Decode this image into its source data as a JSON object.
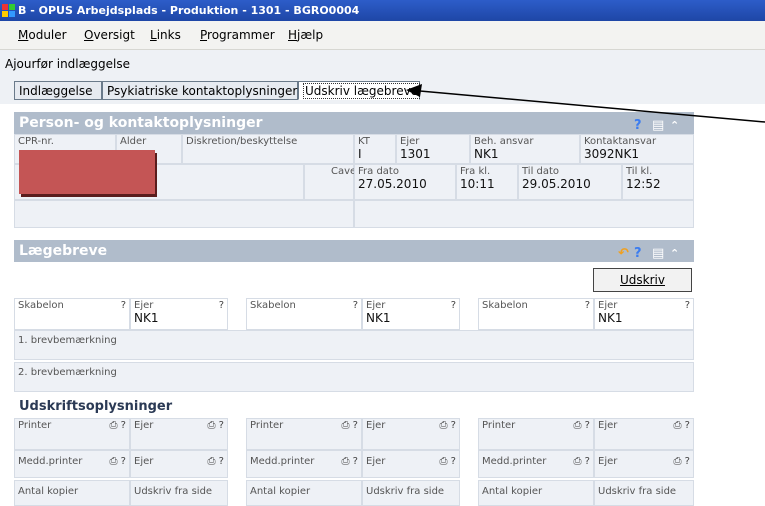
{
  "window": {
    "title": "B - OPUS Arbejdsplads - Produktion - 1301 - BGRO0004"
  },
  "menu": [
    {
      "label": "Moduler",
      "u": "M",
      "rest": "oduler"
    },
    {
      "label": "Oversigt",
      "u": "O",
      "rest": "versigt"
    },
    {
      "label": "Links",
      "u": "L",
      "rest": "inks"
    },
    {
      "label": "Programmer",
      "u": "P",
      "rest": "rogrammer"
    },
    {
      "label": "Hjælp",
      "u": "H",
      "rest": "jælp"
    }
  ],
  "subbar": {
    "label": "Ajourfør indlæggelse"
  },
  "tabs": [
    {
      "label": "Indlæggelse"
    },
    {
      "label": "Psykiatriske kontaktoplysninger"
    },
    {
      "label": "Udskriv lægebreve"
    }
  ],
  "person": {
    "header": "Person- og kontaktoplysninger",
    "cpr_label": "CPR-nr.",
    "alder_label": "Alder",
    "diskretion_label": "Diskretion/beskyttelse",
    "kt_label": "KT",
    "kt_value": "I",
    "ejer_label": "Ejer",
    "ejer_value": "1301",
    "beh_label": "Beh. ansvar",
    "beh_value": "NK1",
    "kontakt_label": "Kontaktansvar",
    "kontakt_value": "3092NK1",
    "cave_label": "Cave",
    "fra_dato_label": "Fra dato",
    "fra_dato_value": "27.05.2010",
    "fra_kl_label": "Fra kl.",
    "fra_kl_value": "10:11",
    "til_dato_label": "Til dato",
    "til_dato_value": "29.05.2010",
    "til_kl_label": "Til kl.",
    "til_kl_value": "12:52"
  },
  "laegebreve": {
    "header": "Lægebreve",
    "print_button": "Udskriv",
    "skabelon_label": "Skabelon",
    "ejer_label": "Ejer",
    "ejer_value": "NK1",
    "q": "?",
    "brev1_label": "1. brevbemærkning",
    "brev2_label": "2. brevbemærkning"
  },
  "udskrift": {
    "title": "Udskriftsoplysninger",
    "printer_label": "Printer",
    "ejer_label": "Ejer",
    "medd_label": "Medd.printer",
    "antal_label": "Antal kopier",
    "fra_side_label": "Udskriv fra side"
  },
  "colors": {
    "titlebar": "#1e46a6",
    "panel_header": "#b0bccb",
    "cell_bg": "#eef1f6",
    "red_block": "#c45555"
  }
}
